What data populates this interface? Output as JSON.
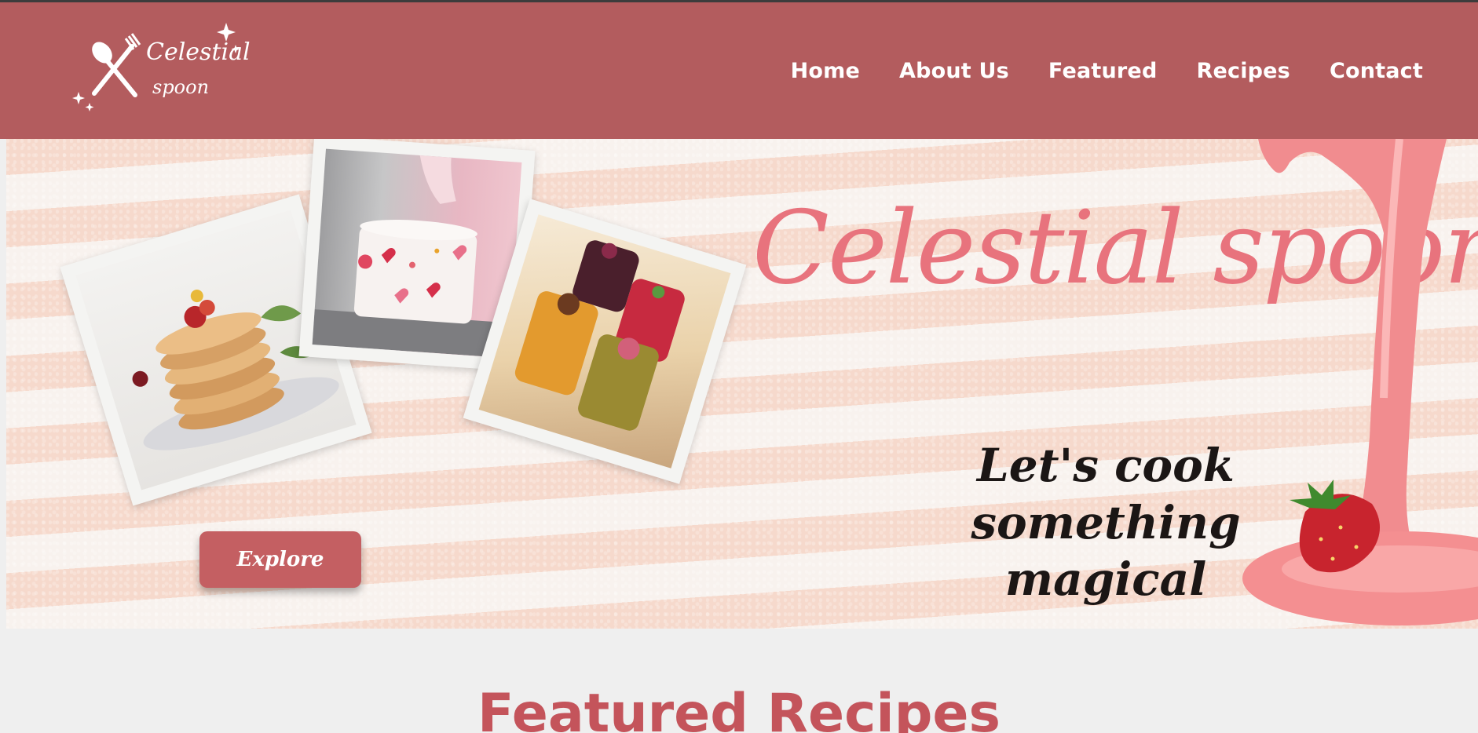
{
  "header": {
    "logo": {
      "line1": "Celestial",
      "line2": "spoon"
    },
    "nav": [
      "Home",
      "About Us",
      "Featured",
      "Recipes",
      "Contact"
    ]
  },
  "hero": {
    "title": "Celestial spoon",
    "subtitle_line1": "Let's cook something",
    "subtitle_line2": "magical",
    "button_label": "Explore",
    "photos": [
      "pancakes-photo",
      "cake-photo",
      "smoothies-photo"
    ]
  },
  "featured": {
    "title": "Featured Recipes"
  },
  "colors": {
    "header_bg": "#b35c5e",
    "accent": "#e8737d",
    "button": "#c45f62",
    "section_title": "#c4545b"
  }
}
